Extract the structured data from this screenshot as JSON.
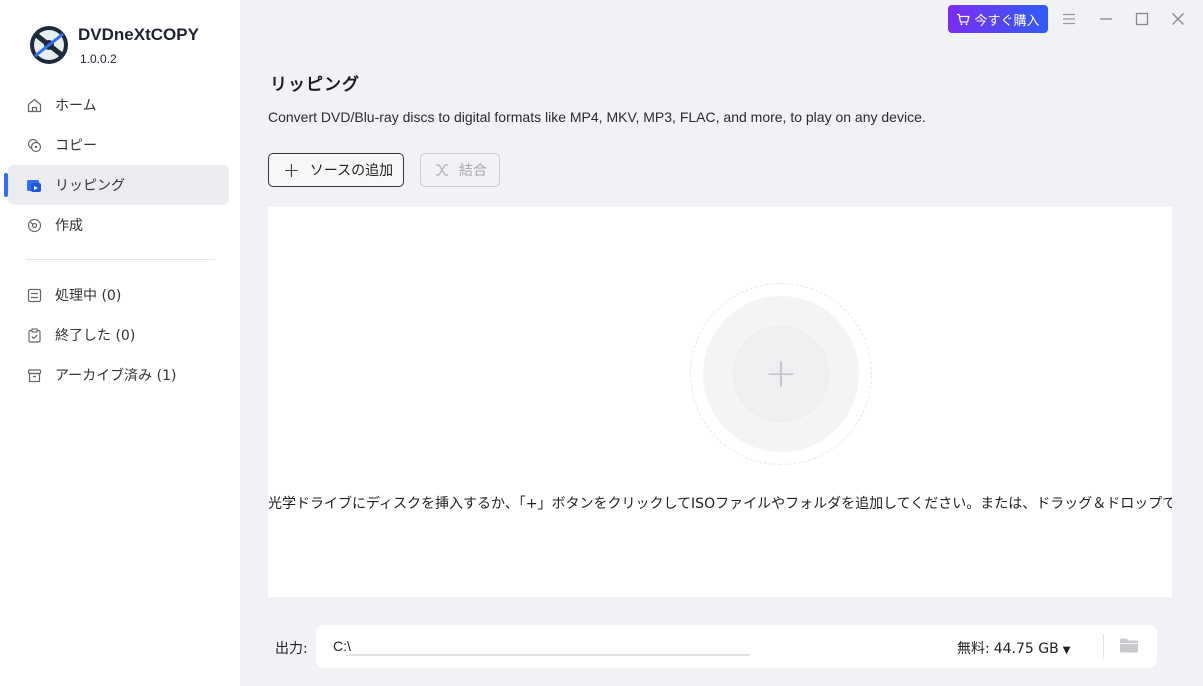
{
  "app": {
    "name": "DVDneXtCOPY",
    "version": "1.0.0.2"
  },
  "titlebar": {
    "buy_label": "今すぐ購入"
  },
  "nav": [
    {
      "label": "ホーム",
      "icon": "home-icon"
    },
    {
      "label": "コピー",
      "icon": "copy-icon"
    },
    {
      "label": "リッピング",
      "icon": "ripping-icon",
      "active": true
    },
    {
      "label": "作成",
      "icon": "create-icon"
    }
  ],
  "nav2": [
    {
      "label": "処理中 (0)",
      "icon": "processing-icon"
    },
    {
      "label": "終了した (0)",
      "icon": "finished-icon"
    },
    {
      "label": "アーカイブ済み (1)",
      "icon": "archive-icon"
    }
  ],
  "main": {
    "title": "リッピング",
    "description": "Convert DVD/Blu-ray discs to digital formats like MP4, MKV, MP3, FLAC, and more, to play on any device.",
    "add_source_label": "ソースの追加",
    "merge_label": "結合",
    "drop_hint": "光学ドライブにディスクを挿入するか、「+」ボタンをクリックしてISOファイルやフォルダを追加してください。または、ドラッグ＆ドロップで"
  },
  "output": {
    "label": "出力:",
    "path": "C:\\",
    "free_label": "無料:",
    "free_value": "44.75 GB"
  },
  "colors": {
    "accent": "#2f6ef6",
    "buy_gradient_start": "#7b2cf0",
    "buy_gradient_end": "#2f5cf5"
  }
}
